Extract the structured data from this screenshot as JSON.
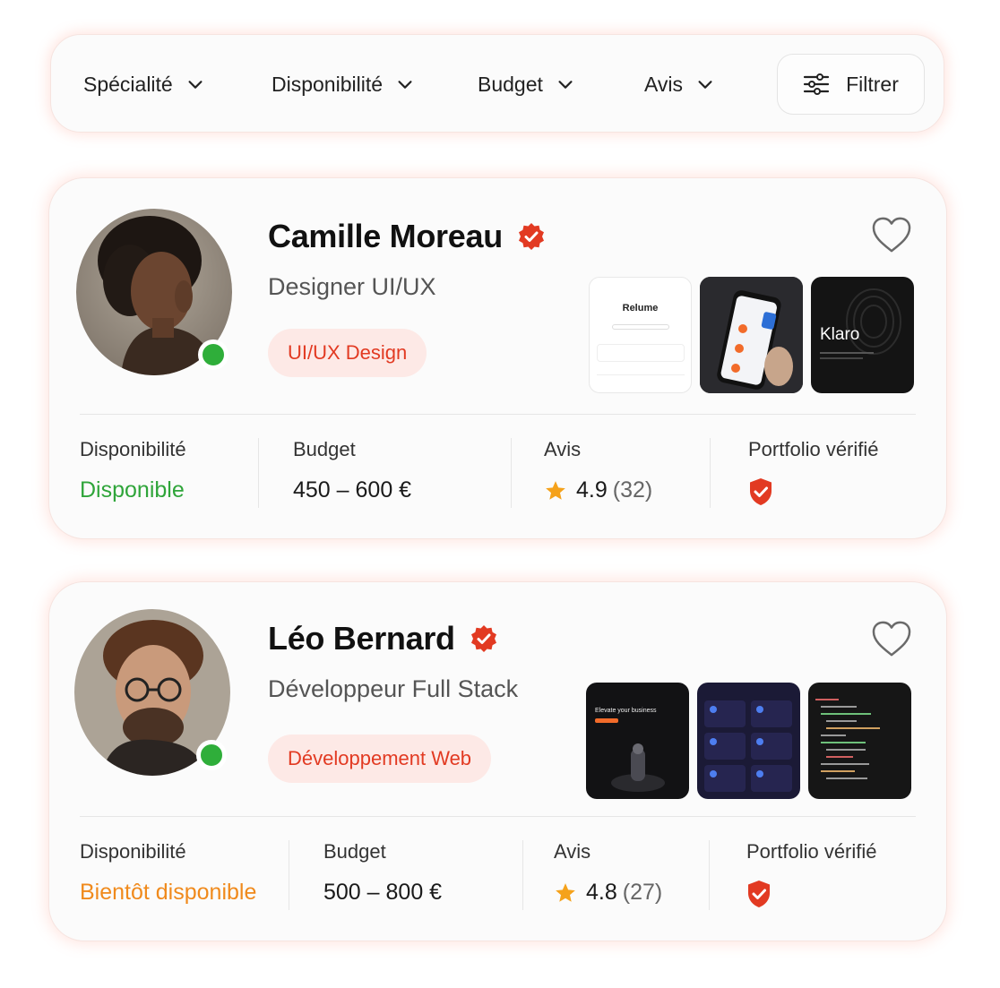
{
  "filters": {
    "items": [
      {
        "label": "Spécialité"
      },
      {
        "label": "Disponibilité"
      },
      {
        "label": "Budget"
      },
      {
        "label": "Avis"
      }
    ],
    "filter_button_label": "Filtrer"
  },
  "freelancers": [
    {
      "name": "Camille Moreau",
      "role": "Designer UI/UX",
      "tag": "UI/UX Design",
      "online": true,
      "portfolio_thumbs": [
        {
          "title": "Relume",
          "theme": "light"
        },
        {
          "title": "",
          "theme": "dark-phone"
        },
        {
          "title": "Klaro",
          "theme": "dark"
        }
      ],
      "stats": {
        "availability_label": "Disponibilité",
        "availability_value": "Disponible",
        "budget_label": "Budget",
        "budget_value": "450 – 600 €",
        "reviews_label": "Avis",
        "rating": "4.9",
        "review_count": "(32)",
        "portfolio_label": "Portfolio vérifié"
      }
    },
    {
      "name": "Léo Bernard",
      "role": "Développeur Full Stack",
      "tag": "Développement Web",
      "online": true,
      "portfolio_thumbs": [
        {
          "title": "Elevate your business",
          "theme": "dark"
        },
        {
          "title": "",
          "theme": "dark-dashboard"
        },
        {
          "title": "",
          "theme": "dark-code"
        }
      ],
      "stats": {
        "availability_label": "Disponibilité",
        "availability_value": "Bientôt disponible",
        "budget_label": "Budget",
        "budget_value": "500 – 800 €",
        "reviews_label": "Avis",
        "rating": "4.8",
        "review_count": "(27)",
        "portfolio_label": "Portfolio vérifié"
      }
    }
  ],
  "colors": {
    "accent": "#e23a22",
    "available": "#2fa53a",
    "soon": "#f08a1c",
    "star": "#f5a21b",
    "online": "#2fae3a"
  }
}
